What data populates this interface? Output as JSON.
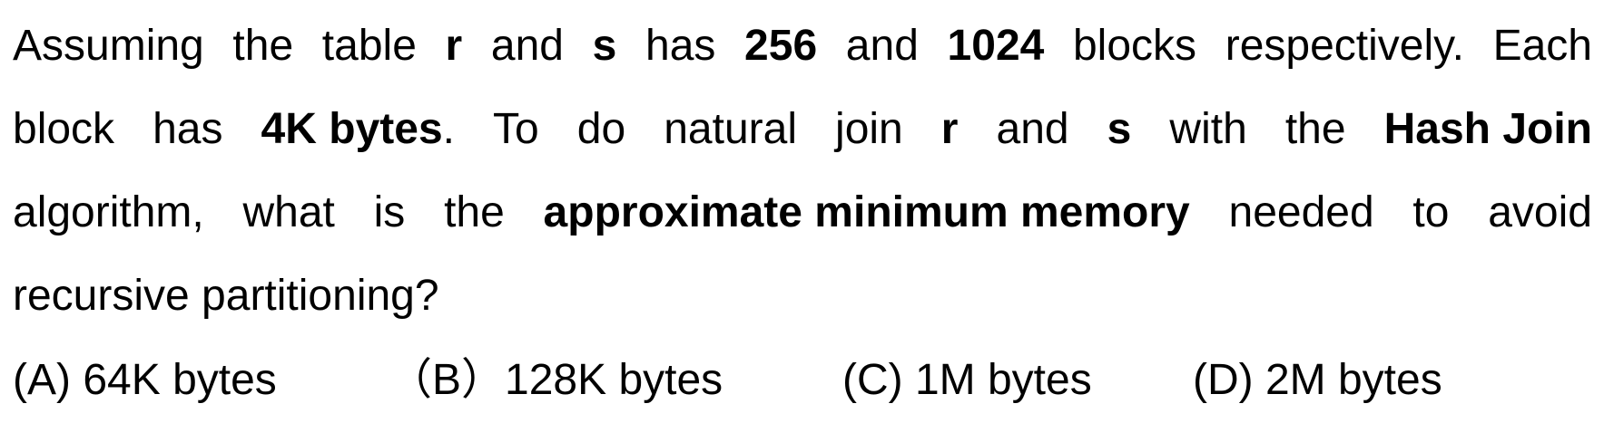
{
  "question": {
    "line1": [
      {
        "t": "Assuming",
        "b": false
      },
      {
        "t": "the",
        "b": false
      },
      {
        "t": "table",
        "b": false
      },
      {
        "t": "r",
        "b": true
      },
      {
        "t": "and",
        "b": false
      },
      {
        "t": "s",
        "b": true
      },
      {
        "t": "has",
        "b": false
      },
      {
        "t": "256",
        "b": true
      },
      {
        "t": "and",
        "b": false
      },
      {
        "t": "1024",
        "b": true
      },
      {
        "t": "blocks",
        "b": false
      },
      {
        "t": "respectively.",
        "b": false
      },
      {
        "t": "Each",
        "b": false
      }
    ],
    "line2": [
      {
        "t": "block",
        "b": false
      },
      {
        "t": "has",
        "b": false
      },
      {
        "t": "4K bytes",
        "b": true,
        "suffix": "."
      },
      {
        "t": "To",
        "b": false
      },
      {
        "t": "do",
        "b": false
      },
      {
        "t": "natural",
        "b": false
      },
      {
        "t": "join",
        "b": false
      },
      {
        "t": "r",
        "b": true
      },
      {
        "t": "and",
        "b": false
      },
      {
        "t": "s",
        "b": true
      },
      {
        "t": "with",
        "b": false
      },
      {
        "t": "the",
        "b": false
      },
      {
        "t": "Hash Join",
        "b": true
      }
    ],
    "line3": [
      {
        "t": "algorithm,",
        "b": false
      },
      {
        "t": "what",
        "b": false
      },
      {
        "t": "is",
        "b": false
      },
      {
        "t": "the",
        "b": false
      },
      {
        "t": "approximate minimum memory",
        "b": true
      },
      {
        "t": "needed",
        "b": false
      },
      {
        "t": "to",
        "b": false
      },
      {
        "t": "avoid",
        "b": false
      }
    ],
    "line4": "recursive partitioning?"
  },
  "options": {
    "a": "(A) 64K bytes",
    "b": "（B）128K bytes",
    "c": "(C) 1M bytes",
    "d": "(D) 2M bytes"
  }
}
